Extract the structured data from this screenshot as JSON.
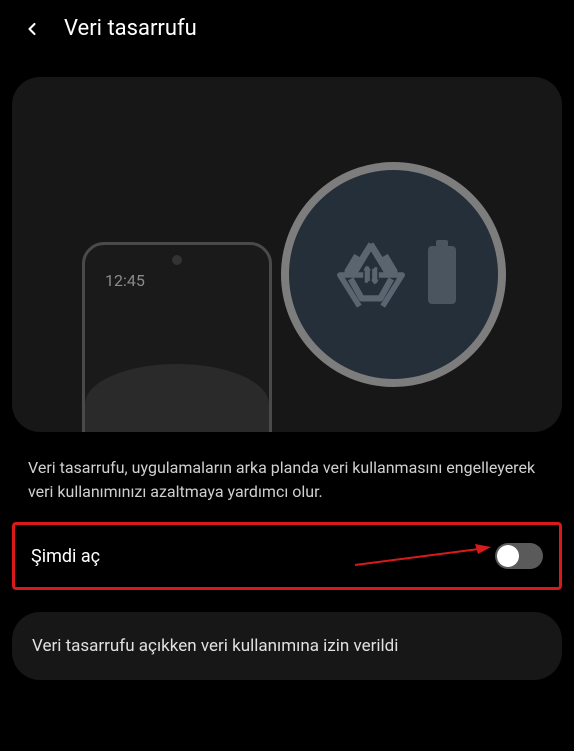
{
  "header": {
    "title": "Veri tasarrufu"
  },
  "illustration": {
    "time": "12:45",
    "icon_name": "data-saver-recycle-icon"
  },
  "description": "Veri tasarrufu, uygulamaların arka planda veri kullanmasını engelleyerek veri kullanımınızı azaltmaya yardımcı olur.",
  "toggle": {
    "label": "Şimdi aç",
    "state": false
  },
  "allowlist": {
    "label": "Veri tasarrufu açıkken veri kullanımına izin verildi"
  }
}
